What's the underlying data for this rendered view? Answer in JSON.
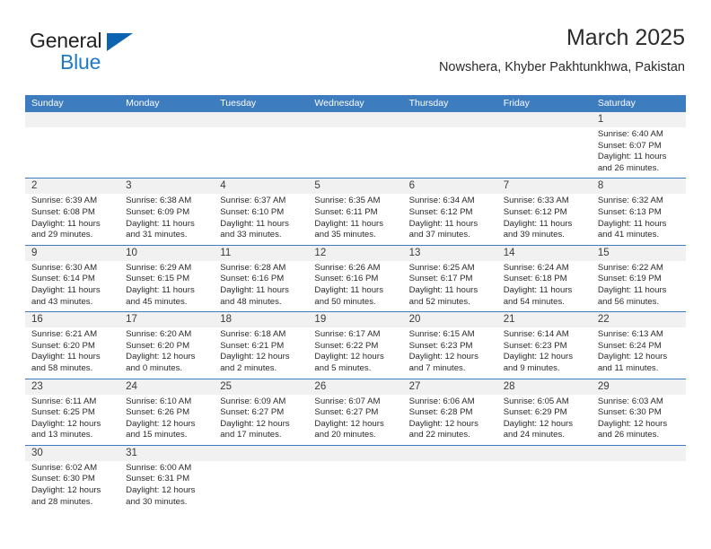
{
  "brand": {
    "name_top": "General",
    "name_bottom": "Blue",
    "accent_color": "#2079c4",
    "flag_color": "#0c64b0"
  },
  "header": {
    "title": "March 2025",
    "subtitle": "Nowshera, Khyber Pakhtunkhwa, Pakistan"
  },
  "calendar": {
    "header_bg": "#3d7cbf",
    "daynum_bg": "#f1f1f1",
    "weekdays": [
      "Sunday",
      "Monday",
      "Tuesday",
      "Wednesday",
      "Thursday",
      "Friday",
      "Saturday"
    ],
    "weeks": [
      [
        {
          "day": "",
          "sunrise": "",
          "sunset": "",
          "daylight_line1": "",
          "daylight_line2": ""
        },
        {
          "day": "",
          "sunrise": "",
          "sunset": "",
          "daylight_line1": "",
          "daylight_line2": ""
        },
        {
          "day": "",
          "sunrise": "",
          "sunset": "",
          "daylight_line1": "",
          "daylight_line2": ""
        },
        {
          "day": "",
          "sunrise": "",
          "sunset": "",
          "daylight_line1": "",
          "daylight_line2": ""
        },
        {
          "day": "",
          "sunrise": "",
          "sunset": "",
          "daylight_line1": "",
          "daylight_line2": ""
        },
        {
          "day": "",
          "sunrise": "",
          "sunset": "",
          "daylight_line1": "",
          "daylight_line2": ""
        },
        {
          "day": "1",
          "sunrise": "Sunrise: 6:40 AM",
          "sunset": "Sunset: 6:07 PM",
          "daylight_line1": "Daylight: 11 hours",
          "daylight_line2": "and 26 minutes."
        }
      ],
      [
        {
          "day": "2",
          "sunrise": "Sunrise: 6:39 AM",
          "sunset": "Sunset: 6:08 PM",
          "daylight_line1": "Daylight: 11 hours",
          "daylight_line2": "and 29 minutes."
        },
        {
          "day": "3",
          "sunrise": "Sunrise: 6:38 AM",
          "sunset": "Sunset: 6:09 PM",
          "daylight_line1": "Daylight: 11 hours",
          "daylight_line2": "and 31 minutes."
        },
        {
          "day": "4",
          "sunrise": "Sunrise: 6:37 AM",
          "sunset": "Sunset: 6:10 PM",
          "daylight_line1": "Daylight: 11 hours",
          "daylight_line2": "and 33 minutes."
        },
        {
          "day": "5",
          "sunrise": "Sunrise: 6:35 AM",
          "sunset": "Sunset: 6:11 PM",
          "daylight_line1": "Daylight: 11 hours",
          "daylight_line2": "and 35 minutes."
        },
        {
          "day": "6",
          "sunrise": "Sunrise: 6:34 AM",
          "sunset": "Sunset: 6:12 PM",
          "daylight_line1": "Daylight: 11 hours",
          "daylight_line2": "and 37 minutes."
        },
        {
          "day": "7",
          "sunrise": "Sunrise: 6:33 AM",
          "sunset": "Sunset: 6:12 PM",
          "daylight_line1": "Daylight: 11 hours",
          "daylight_line2": "and 39 minutes."
        },
        {
          "day": "8",
          "sunrise": "Sunrise: 6:32 AM",
          "sunset": "Sunset: 6:13 PM",
          "daylight_line1": "Daylight: 11 hours",
          "daylight_line2": "and 41 minutes."
        }
      ],
      [
        {
          "day": "9",
          "sunrise": "Sunrise: 6:30 AM",
          "sunset": "Sunset: 6:14 PM",
          "daylight_line1": "Daylight: 11 hours",
          "daylight_line2": "and 43 minutes."
        },
        {
          "day": "10",
          "sunrise": "Sunrise: 6:29 AM",
          "sunset": "Sunset: 6:15 PM",
          "daylight_line1": "Daylight: 11 hours",
          "daylight_line2": "and 45 minutes."
        },
        {
          "day": "11",
          "sunrise": "Sunrise: 6:28 AM",
          "sunset": "Sunset: 6:16 PM",
          "daylight_line1": "Daylight: 11 hours",
          "daylight_line2": "and 48 minutes."
        },
        {
          "day": "12",
          "sunrise": "Sunrise: 6:26 AM",
          "sunset": "Sunset: 6:16 PM",
          "daylight_line1": "Daylight: 11 hours",
          "daylight_line2": "and 50 minutes."
        },
        {
          "day": "13",
          "sunrise": "Sunrise: 6:25 AM",
          "sunset": "Sunset: 6:17 PM",
          "daylight_line1": "Daylight: 11 hours",
          "daylight_line2": "and 52 minutes."
        },
        {
          "day": "14",
          "sunrise": "Sunrise: 6:24 AM",
          "sunset": "Sunset: 6:18 PM",
          "daylight_line1": "Daylight: 11 hours",
          "daylight_line2": "and 54 minutes."
        },
        {
          "day": "15",
          "sunrise": "Sunrise: 6:22 AM",
          "sunset": "Sunset: 6:19 PM",
          "daylight_line1": "Daylight: 11 hours",
          "daylight_line2": "and 56 minutes."
        }
      ],
      [
        {
          "day": "16",
          "sunrise": "Sunrise: 6:21 AM",
          "sunset": "Sunset: 6:20 PM",
          "daylight_line1": "Daylight: 11 hours",
          "daylight_line2": "and 58 minutes."
        },
        {
          "day": "17",
          "sunrise": "Sunrise: 6:20 AM",
          "sunset": "Sunset: 6:20 PM",
          "daylight_line1": "Daylight: 12 hours",
          "daylight_line2": "and 0 minutes."
        },
        {
          "day": "18",
          "sunrise": "Sunrise: 6:18 AM",
          "sunset": "Sunset: 6:21 PM",
          "daylight_line1": "Daylight: 12 hours",
          "daylight_line2": "and 2 minutes."
        },
        {
          "day": "19",
          "sunrise": "Sunrise: 6:17 AM",
          "sunset": "Sunset: 6:22 PM",
          "daylight_line1": "Daylight: 12 hours",
          "daylight_line2": "and 5 minutes."
        },
        {
          "day": "20",
          "sunrise": "Sunrise: 6:15 AM",
          "sunset": "Sunset: 6:23 PM",
          "daylight_line1": "Daylight: 12 hours",
          "daylight_line2": "and 7 minutes."
        },
        {
          "day": "21",
          "sunrise": "Sunrise: 6:14 AM",
          "sunset": "Sunset: 6:23 PM",
          "daylight_line1": "Daylight: 12 hours",
          "daylight_line2": "and 9 minutes."
        },
        {
          "day": "22",
          "sunrise": "Sunrise: 6:13 AM",
          "sunset": "Sunset: 6:24 PM",
          "daylight_line1": "Daylight: 12 hours",
          "daylight_line2": "and 11 minutes."
        }
      ],
      [
        {
          "day": "23",
          "sunrise": "Sunrise: 6:11 AM",
          "sunset": "Sunset: 6:25 PM",
          "daylight_line1": "Daylight: 12 hours",
          "daylight_line2": "and 13 minutes."
        },
        {
          "day": "24",
          "sunrise": "Sunrise: 6:10 AM",
          "sunset": "Sunset: 6:26 PM",
          "daylight_line1": "Daylight: 12 hours",
          "daylight_line2": "and 15 minutes."
        },
        {
          "day": "25",
          "sunrise": "Sunrise: 6:09 AM",
          "sunset": "Sunset: 6:27 PM",
          "daylight_line1": "Daylight: 12 hours",
          "daylight_line2": "and 17 minutes."
        },
        {
          "day": "26",
          "sunrise": "Sunrise: 6:07 AM",
          "sunset": "Sunset: 6:27 PM",
          "daylight_line1": "Daylight: 12 hours",
          "daylight_line2": "and 20 minutes."
        },
        {
          "day": "27",
          "sunrise": "Sunrise: 6:06 AM",
          "sunset": "Sunset: 6:28 PM",
          "daylight_line1": "Daylight: 12 hours",
          "daylight_line2": "and 22 minutes."
        },
        {
          "day": "28",
          "sunrise": "Sunrise: 6:05 AM",
          "sunset": "Sunset: 6:29 PM",
          "daylight_line1": "Daylight: 12 hours",
          "daylight_line2": "and 24 minutes."
        },
        {
          "day": "29",
          "sunrise": "Sunrise: 6:03 AM",
          "sunset": "Sunset: 6:30 PM",
          "daylight_line1": "Daylight: 12 hours",
          "daylight_line2": "and 26 minutes."
        }
      ],
      [
        {
          "day": "30",
          "sunrise": "Sunrise: 6:02 AM",
          "sunset": "Sunset: 6:30 PM",
          "daylight_line1": "Daylight: 12 hours",
          "daylight_line2": "and 28 minutes."
        },
        {
          "day": "31",
          "sunrise": "Sunrise: 6:00 AM",
          "sunset": "Sunset: 6:31 PM",
          "daylight_line1": "Daylight: 12 hours",
          "daylight_line2": "and 30 minutes."
        },
        {
          "day": "",
          "sunrise": "",
          "sunset": "",
          "daylight_line1": "",
          "daylight_line2": ""
        },
        {
          "day": "",
          "sunrise": "",
          "sunset": "",
          "daylight_line1": "",
          "daylight_line2": ""
        },
        {
          "day": "",
          "sunrise": "",
          "sunset": "",
          "daylight_line1": "",
          "daylight_line2": ""
        },
        {
          "day": "",
          "sunrise": "",
          "sunset": "",
          "daylight_line1": "",
          "daylight_line2": ""
        },
        {
          "day": "",
          "sunrise": "",
          "sunset": "",
          "daylight_line1": "",
          "daylight_line2": ""
        }
      ]
    ]
  }
}
